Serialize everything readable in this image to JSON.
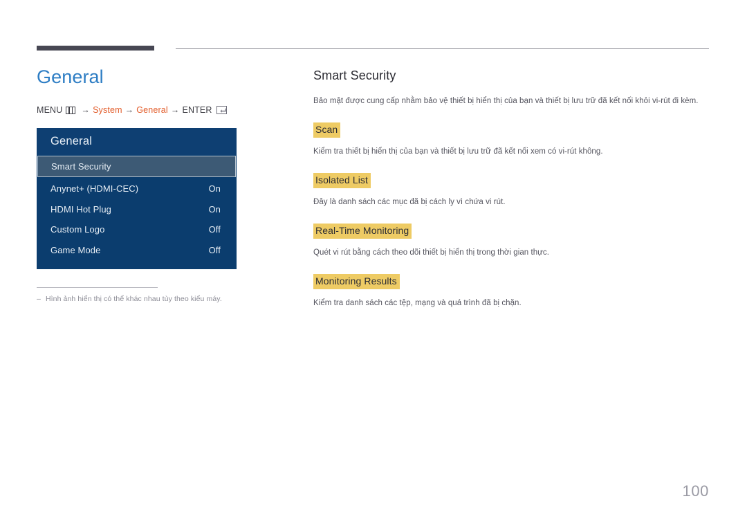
{
  "header": {
    "rule_color": "#474753",
    "thin_rule_color": "#8d8d96"
  },
  "left": {
    "page_title": "General",
    "breadcrumb": {
      "menu_label": "MENU",
      "menu_icon": "menu-grid-icon",
      "arrow": "→",
      "step1": "System",
      "step2": "General",
      "enter_label": "ENTER",
      "enter_icon": "enter-key-icon"
    },
    "osd": {
      "title": "General",
      "rows": [
        {
          "label": "Smart Security",
          "value": "",
          "selected": true
        },
        {
          "label": "Anynet+ (HDMI-CEC)",
          "value": "On",
          "selected": false
        },
        {
          "label": "HDMI Hot Plug",
          "value": "On",
          "selected": false
        },
        {
          "label": "Custom Logo",
          "value": "Off",
          "selected": false
        },
        {
          "label": "Game Mode",
          "value": "Off",
          "selected": false
        }
      ],
      "panel_bg": "#0b3d6e",
      "title_bg": "#0e3f72",
      "selected_bg": "#3d5a75"
    },
    "footnote": {
      "dash": "–",
      "text": "Hình ảnh hiển thị có thể khác nhau tùy theo kiểu máy."
    }
  },
  "right": {
    "section_title": "Smart Security",
    "section_desc": "Bảo mật được cung cấp nhằm bảo vệ thiết bị hiển thị của bạn và thiết bị lưu trữ đã kết nối khỏi vi-rút đi kèm.",
    "highlight_color": "#eecb64",
    "subsections": [
      {
        "title": "Scan",
        "desc": "Kiểm tra thiết bị hiển thị của bạn và thiết bị lưu trữ đã kết nối xem có vi-rút không."
      },
      {
        "title": "Isolated List",
        "desc": "Đây là danh sách các mục đã bị cách ly vì chứa vi rút."
      },
      {
        "title": "Real-Time Monitoring",
        "desc": "Quét vi rút bằng cách theo dõi thiết bị hiển thị trong thời gian thực."
      },
      {
        "title": "Monitoring Results",
        "desc": "Kiểm tra danh sách các tệp, mạng và quá trình đã bị chặn."
      }
    ]
  },
  "footer": {
    "page_number": "100"
  }
}
